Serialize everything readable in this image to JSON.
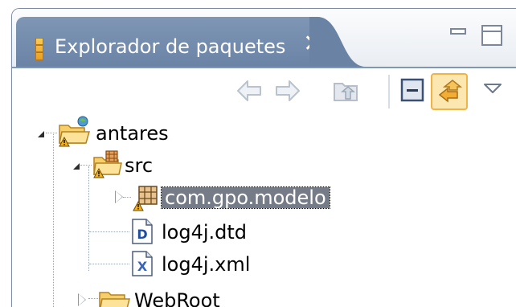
{
  "view": {
    "title": "Explorador de paquetes",
    "close_glyph": "✕"
  },
  "toolbar": {
    "buttons": [
      "back-arrow-icon",
      "forward-arrow-icon",
      "up-folder-icon",
      "collapse-all-icon",
      "link-with-editor-icon",
      "view-menu-icon"
    ]
  },
  "tree": {
    "items": [
      {
        "label": "antares",
        "icon": "project-folder-icon",
        "state": "expanded"
      },
      {
        "label": "src",
        "icon": "source-folder-icon",
        "state": "expanded"
      },
      {
        "label": "com.gpo.modelo",
        "icon": "package-icon",
        "state": "collapsed",
        "selected": true
      },
      {
        "label": "log4j.dtd",
        "icon": "dtd-file-icon"
      },
      {
        "label": "log4j.xml",
        "icon": "xml-file-icon"
      },
      {
        "label": "WebRoot",
        "icon": "folder-icon",
        "state": "collapsed"
      }
    ]
  },
  "colors": {
    "tab_active": "#7890b0",
    "selection": "#757c87",
    "toggle_bg": "#fde7b0",
    "warning": "#f2b01e"
  }
}
